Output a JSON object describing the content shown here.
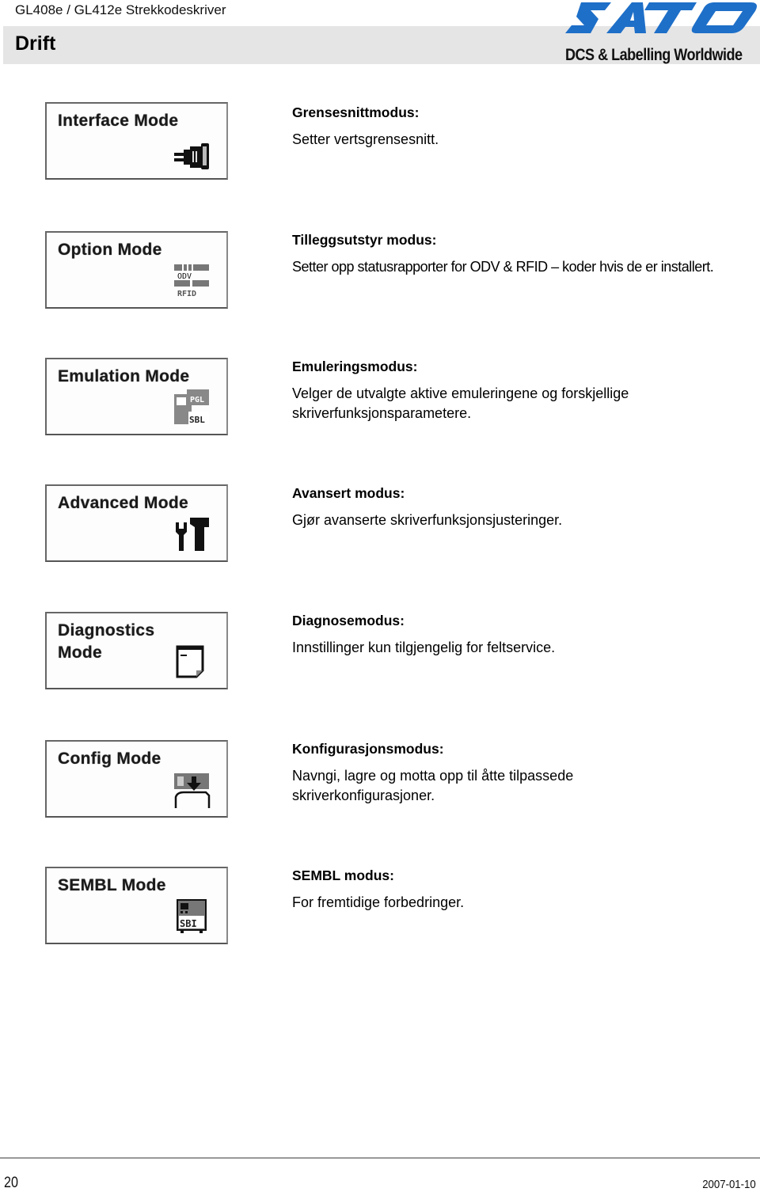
{
  "header": {
    "document_title": "GL408e / GL412e Strekkodeskriver",
    "section_title": "Drift",
    "logo": {
      "brand": "SATO",
      "tagline": "DCS & Labelling Worldwide",
      "brand_color": "#1e6fc8"
    }
  },
  "modes": [
    {
      "lcd_label": "Interface Mode",
      "icon": "connector-plug-icon",
      "heading": "Grensesnittmodus:",
      "description": "Setter vertsgrensesnitt."
    },
    {
      "lcd_label": "Option Mode",
      "icon": "odv-rfid-icon",
      "heading": "Tilleggsutstyr modus:",
      "description": "Setter opp statusrapporter for ODV & RFID – koder hvis de er installert."
    },
    {
      "lcd_label": "Emulation Mode",
      "icon": "emulation-pgl-sbl-icon",
      "heading": "Emuleringsmodus:",
      "description": "Velger de utvalgte aktive emuleringene og forskjellige skriverfunksjonsparametere."
    },
    {
      "lcd_label": "Advanced Mode",
      "icon": "wrench-hammer-icon",
      "heading": "Avansert modus:",
      "description": "Gjør avanserte skriverfunksjonsjusteringer."
    },
    {
      "lcd_label": "Diagnostics Mode",
      "icon": "page-document-icon",
      "heading": "Diagnosemodus:",
      "description": "Innstillinger kun tilgjengelig for feltservice."
    },
    {
      "lcd_label": "Config Mode",
      "icon": "config-download-icon",
      "heading": "Konfigurasjonsmodus:",
      "description": "Navngi, lagre og motta opp til åtte tilpassede skriverkonfigurasjoner."
    },
    {
      "lcd_label": "SEMBL Mode",
      "icon": "sbi-device-icon",
      "heading": "SEMBL modus:",
      "description": "For fremtidige forbedringer."
    }
  ],
  "footer": {
    "page_number": "20",
    "date": "2007-01-10"
  }
}
